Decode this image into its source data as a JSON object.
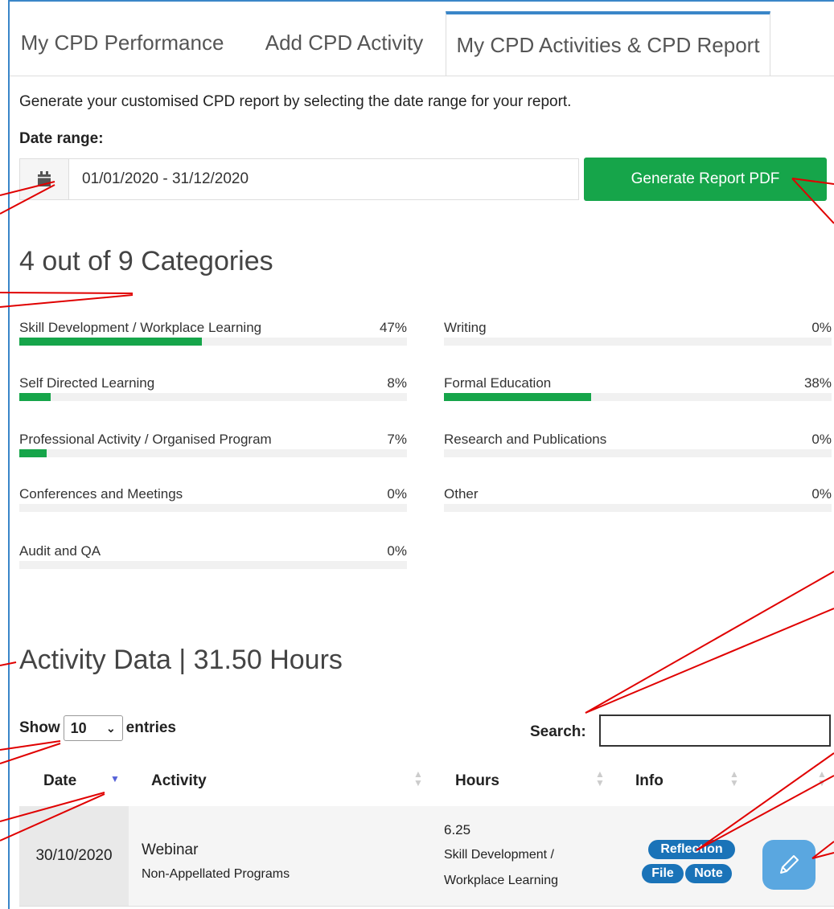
{
  "tabs": [
    {
      "label": "My CPD Performance"
    },
    {
      "label": "Add CPD Activity"
    },
    {
      "label": "My CPD Activities & CPD Report"
    }
  ],
  "intro_text": "Generate your customised CPD report by selecting the date range for your report.",
  "date_range": {
    "label": "Date range:",
    "value": "01/01/2020 - 31/12/2020",
    "icon": "calendar-icon"
  },
  "generate_button": "Generate Report PDF",
  "categories_title": "4 out of 9 Categories",
  "categories_left": [
    {
      "name": "Skill Development / Workplace Learning",
      "pct": "47%",
      "value": 47
    },
    {
      "name": "Self Directed Learning",
      "pct": "8%",
      "value": 8
    },
    {
      "name": "Professional Activity / Organised Program",
      "pct": "7%",
      "value": 7
    },
    {
      "name": "Conferences and Meetings",
      "pct": "0%",
      "value": 0
    },
    {
      "name": "Audit and QA",
      "pct": "0%",
      "value": 0
    }
  ],
  "categories_right": [
    {
      "name": "Writing",
      "pct": "0%",
      "value": 0
    },
    {
      "name": "Formal Education",
      "pct": "38%",
      "value": 38
    },
    {
      "name": "Research and Publications",
      "pct": "0%",
      "value": 0
    },
    {
      "name": "Other",
      "pct": "0%",
      "value": 0
    }
  ],
  "activity_title": "Activity Data | 31.50 Hours",
  "table_controls": {
    "show_label": "Show",
    "entries_value": "10",
    "entries_label": "entries",
    "search_label": "Search:"
  },
  "columns": [
    "Date",
    "Activity",
    "Hours",
    "Info"
  ],
  "rows": [
    {
      "date": "30/10/2020",
      "activity": "Webinar",
      "activity_sub": "Non-Appellated Programs",
      "hours": "6.25",
      "category_line1": "Skill Development /",
      "category_line2": "Workplace Learning",
      "badges": [
        "Reflection",
        "File",
        "Note"
      ]
    }
  ],
  "colors": {
    "accent": "#3a86c8",
    "green": "#16a54a",
    "badge": "#1a73b8",
    "arrow": "#e00000"
  }
}
